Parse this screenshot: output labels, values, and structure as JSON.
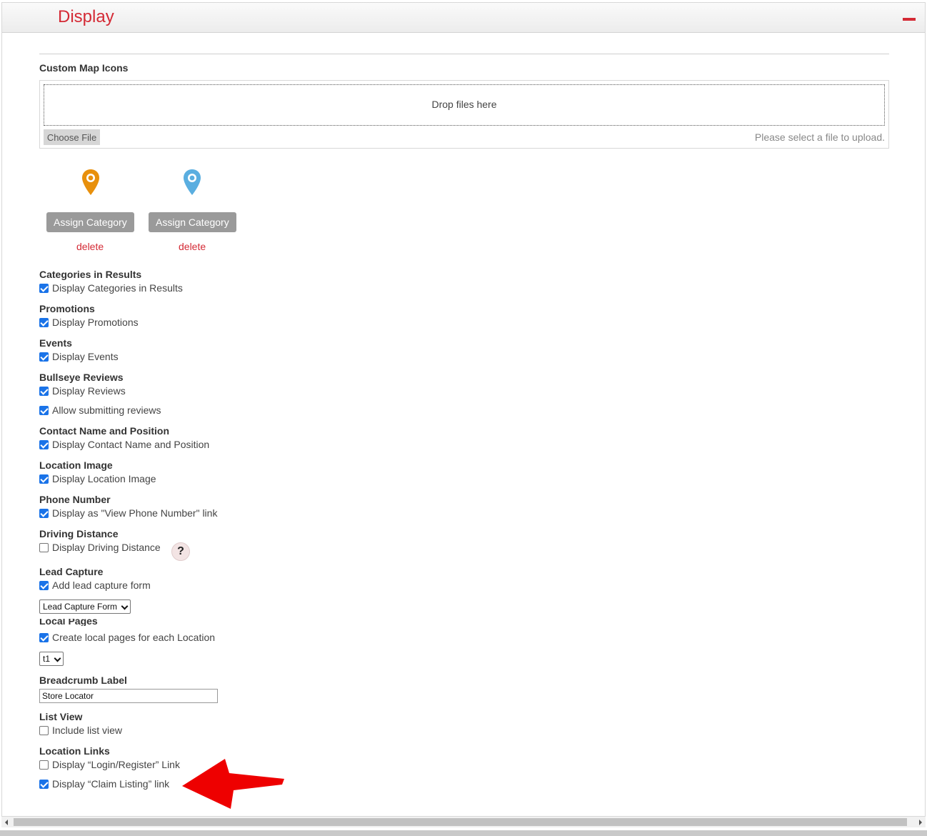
{
  "panel": {
    "title": "Display"
  },
  "icons_section": {
    "label": "Custom Map Icons",
    "dropzone_text": "Drop files here",
    "choose_file_label": "Choose File",
    "upload_hint": "Please select a file to upload."
  },
  "map_icons": [
    {
      "color": "#e8900c",
      "assign_label": "Assign Category",
      "delete_label": "delete"
    },
    {
      "color": "#5aaee0",
      "assign_label": "Assign Category",
      "delete_label": "delete"
    }
  ],
  "settings": {
    "categories": {
      "title": "Categories in Results",
      "label": "Display Categories in Results",
      "checked": true
    },
    "promotions": {
      "title": "Promotions",
      "label": "Display Promotions",
      "checked": true
    },
    "events": {
      "title": "Events",
      "label": "Display Events",
      "checked": true
    },
    "reviews": {
      "title": "Bullseye Reviews",
      "display_label": "Display Reviews",
      "display_checked": true,
      "allow_label": "Allow submitting reviews",
      "allow_checked": true
    },
    "contact": {
      "title": "Contact Name and Position",
      "label": "Display Contact Name and Position",
      "checked": true
    },
    "location_image": {
      "title": "Location Image",
      "label": "Display Location Image",
      "checked": true
    },
    "phone": {
      "title": "Phone Number",
      "label": "Display as \"View Phone Number\" link",
      "checked": true
    },
    "driving": {
      "title": "Driving Distance",
      "label": "Display Driving Distance",
      "checked": false,
      "help": "?"
    },
    "lead_capture": {
      "title": "Lead Capture",
      "label": "Add lead capture form",
      "checked": true,
      "selected": "Lead Capture Form"
    },
    "local_pages": {
      "title": "Local Pages",
      "label": "Create local pages for each Location",
      "checked": true,
      "selected": "t1"
    },
    "breadcrumb": {
      "title": "Breadcrumb Label",
      "value": "Store Locator"
    },
    "list_view": {
      "title": "List View",
      "label": "Include list view",
      "checked": false
    },
    "location_links": {
      "title": "Location Links",
      "login_label": "Display “Login/Register” Link",
      "login_checked": false,
      "claim_label": "Display “Claim Listing” link",
      "claim_checked": true
    }
  },
  "colors": {
    "accent": "#d42a35",
    "checkbox": "#1a73e8",
    "annotation_arrow": "#ee0000"
  }
}
